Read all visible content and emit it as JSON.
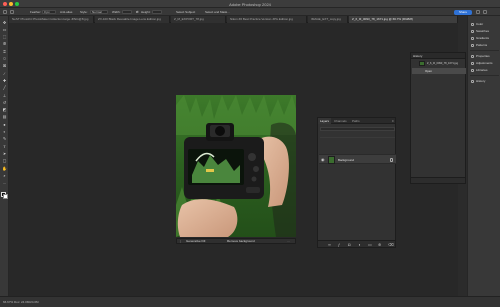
{
  "window": {
    "title": "Adobe Photoshop 2024"
  },
  "options_bar": {
    "feather_label": "Feather:",
    "feather_value": "0 px",
    "antialias_label": "Anti-alias",
    "style_label": "Style:",
    "style_value": "Normal",
    "width_label": "Width:",
    "height_label": "Height:",
    "select_mask_label": "Select and Mask...",
    "share_label": "Share",
    "tool_label": "Select Subject",
    "refine_label": "Select and Mask..."
  },
  "tabs": [
    {
      "label": "NeST PhotoKit PhotoMaker.Collection.large.JPEG@8.jpg"
    },
    {
      "label": "ZX-100 Black Reusable.Image.Lens.Edition.jpg"
    },
    {
      "label": "Z_M_EXPORT_78.jpg"
    },
    {
      "label": "Nikon Z6 Best Practice.Version.JPG.Edition.jpg"
    },
    {
      "label": "IMAGE_EXT_copy.jpg"
    },
    {
      "label": "Z_6_III_0093_78_1671.jpg @ 66.7% (RGB/8)"
    }
  ],
  "tools": [
    {
      "name": "move-tool",
      "glyph": "✥"
    },
    {
      "name": "artboard-tool",
      "glyph": "▭"
    },
    {
      "name": "marquee-tool",
      "glyph": "⬚"
    },
    {
      "name": "lasso-tool",
      "glyph": "ᘓ"
    },
    {
      "name": "object-selection-tool",
      "glyph": "⌗"
    },
    {
      "name": "crop-tool",
      "glyph": "⌑"
    },
    {
      "name": "frame-tool",
      "glyph": "⊠"
    },
    {
      "name": "eyedropper-tool",
      "glyph": "⁄"
    },
    {
      "name": "healing-brush-tool",
      "glyph": "✚"
    },
    {
      "name": "brush-tool",
      "glyph": "╱"
    },
    {
      "name": "clone-stamp-tool",
      "glyph": "⊥"
    },
    {
      "name": "history-brush-tool",
      "glyph": "↺"
    },
    {
      "name": "eraser-tool",
      "glyph": "◩"
    },
    {
      "name": "gradient-tool",
      "glyph": "▤"
    },
    {
      "name": "blur-tool",
      "glyph": "●"
    },
    {
      "name": "dodge-tool",
      "glyph": "◐"
    },
    {
      "name": "pen-tool",
      "glyph": "✎"
    },
    {
      "name": "type-tool",
      "glyph": "T"
    },
    {
      "name": "path-selection-tool",
      "glyph": "➤"
    },
    {
      "name": "rectangle-tool",
      "glyph": "▢"
    },
    {
      "name": "hand-tool",
      "glyph": "✋"
    },
    {
      "name": "zoom-tool",
      "glyph": "⌕"
    },
    {
      "name": "more-tools",
      "glyph": "…"
    }
  ],
  "contextual_taskbar": {
    "select_subject": "Generative Fill",
    "remove_bg": "Remove background"
  },
  "layers_panel": {
    "tabs": [
      "Layers",
      "Channels",
      "Paths"
    ],
    "active_tab": "Layers",
    "filter_label": "Kind",
    "blend_mode": "Normal",
    "opacity_label": "Opacity: 100%",
    "layer_name": "Background"
  },
  "history_panel": {
    "title": "History",
    "snapshot_label": "Z_6_III_0093_78_1671.jpg",
    "state_label": "Open"
  },
  "dock": {
    "items": [
      {
        "label": "Color"
      },
      {
        "label": "Swatches"
      },
      {
        "label": "Gradients"
      },
      {
        "label": "Patterns"
      },
      {
        "label": "Properties"
      },
      {
        "label": "Adjustments"
      },
      {
        "label": "Libraries"
      },
      {
        "label": "History"
      }
    ]
  },
  "status_bar": {
    "zoom_text": "66.67%   Doc: 24.0M/24.0M"
  },
  "colors": {
    "accent": "#2f72d6",
    "panel_bg": "#323232",
    "canvas_bg": "#282828"
  }
}
